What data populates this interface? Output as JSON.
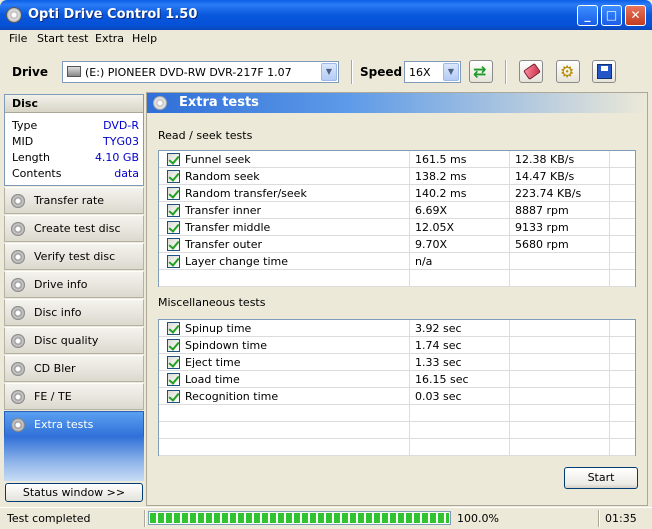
{
  "window": {
    "title": "Opti Drive Control 1.50"
  },
  "menu": [
    "File",
    "Start test",
    "Extra",
    "Help"
  ],
  "toolbar": {
    "drive_label": "Drive",
    "drive_value": "(E:)  PIONEER DVD-RW  DVR-217F 1.07",
    "speed_label": "Speed",
    "speed_value": "16X"
  },
  "disc": {
    "header": "Disc",
    "rows": [
      {
        "k": "Type",
        "v": "DVD-R"
      },
      {
        "k": "MID",
        "v": "TYG03"
      },
      {
        "k": "Length",
        "v": "4.10 GB"
      },
      {
        "k": "Contents",
        "v": "data"
      }
    ]
  },
  "nav": [
    "Transfer rate",
    "Create test disc",
    "Verify test disc",
    "Drive info",
    "Disc info",
    "Disc quality",
    "CD Bler",
    "FE / TE",
    "Extra tests"
  ],
  "status_window_button": "Status window >>",
  "main": {
    "title": "Extra tests",
    "read_seek_label": "Read / seek tests",
    "read_seek": [
      {
        "name": "Funnel seek",
        "v1": "161.5 ms",
        "v2": "12.38 KB/s"
      },
      {
        "name": "Random seek",
        "v1": "138.2 ms",
        "v2": "14.47 KB/s"
      },
      {
        "name": "Random transfer/seek",
        "v1": "140.2 ms",
        "v2": "223.74 KB/s"
      },
      {
        "name": "Transfer inner",
        "v1": "6.69X",
        "v2": "8887 rpm"
      },
      {
        "name": "Transfer middle",
        "v1": "12.05X",
        "v2": "9133 rpm"
      },
      {
        "name": "Transfer outer",
        "v1": "9.70X",
        "v2": "5680 rpm"
      },
      {
        "name": "Layer change time",
        "v1": "n/a",
        "v2": ""
      }
    ],
    "misc_label": "Miscellaneous tests",
    "misc": [
      {
        "name": "Spinup time",
        "v1": "3.92 sec"
      },
      {
        "name": "Spindown time",
        "v1": "1.74 sec"
      },
      {
        "name": "Eject time",
        "v1": "1.33 sec"
      },
      {
        "name": "Load time",
        "v1": "16.15 sec"
      },
      {
        "name": "Recognition time",
        "v1": "0.03 sec"
      }
    ],
    "start_button": "Start"
  },
  "status": {
    "text": "Test completed",
    "progress_fraction": 1.0,
    "percent": "100.0%",
    "time": "01:35"
  }
}
